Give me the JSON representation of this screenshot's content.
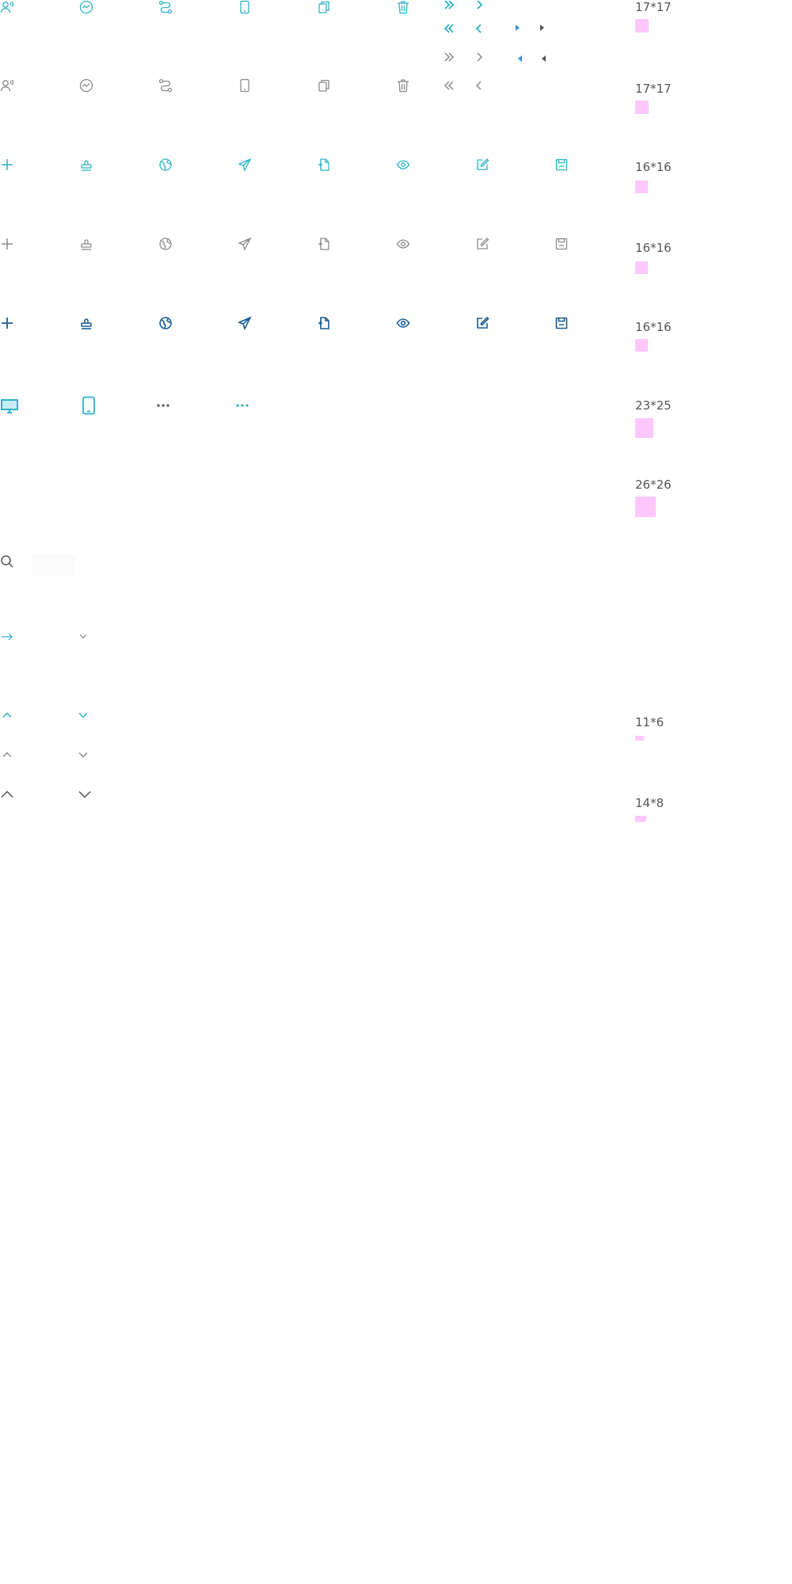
{
  "colors": {
    "teal": "#29b3c8",
    "gray": "#8a8a8a",
    "navy": "#1a5d96",
    "dark": "#555555",
    "blue": "#3d8fd6",
    "swatch": "#fec7fb"
  },
  "rows": [
    {
      "label": "17*17",
      "icons": [
        "user-voice-icon",
        "activity-icon",
        "route-icon",
        "mobile-icon",
        "copy-icon",
        "trash-icon"
      ],
      "color": "teal"
    },
    {
      "label": "17*17",
      "icons": [
        "user-voice-icon",
        "activity-icon",
        "route-icon",
        "mobile-icon",
        "copy-icon",
        "trash-icon"
      ],
      "color": "gray"
    },
    {
      "label": "16*16",
      "icons": [
        "plus-icon",
        "stamp-icon",
        "globe-icon",
        "send-icon",
        "file-add-icon",
        "eye-icon",
        "edit-icon",
        "save-icon"
      ],
      "color": "teal"
    },
    {
      "label": "16*16",
      "icons": [
        "plus-icon",
        "stamp-icon",
        "globe-icon",
        "send-icon",
        "file-add-icon",
        "eye-icon",
        "edit-icon",
        "save-icon"
      ],
      "color": "gray"
    },
    {
      "label": "16*16",
      "icons": [
        "plus-icon",
        "stamp-icon",
        "globe-icon",
        "send-icon",
        "file-add-icon",
        "eye-icon",
        "edit-icon",
        "save-icon"
      ],
      "color": "navy"
    },
    {
      "label": "23*25",
      "icons": [
        "desktop-icon",
        "tablet-icon",
        "more-icon",
        "more-icon"
      ],
      "color": "teal"
    },
    {
      "label": "26*26",
      "icons": [],
      "color": "teal"
    },
    {
      "label": "11*6",
      "icons": [
        "chevron-up-icon",
        "chevron-down-icon"
      ],
      "color": "teal"
    },
    {
      "label": "14*8",
      "icons": [
        "chevron-up-icon",
        "chevron-down-icon"
      ],
      "color": "dark"
    }
  ],
  "pager_icons": [
    "double-right-icon",
    "right-icon",
    "double-left-icon",
    "left-icon",
    "caret-right-icon",
    "caret-left-icon"
  ]
}
